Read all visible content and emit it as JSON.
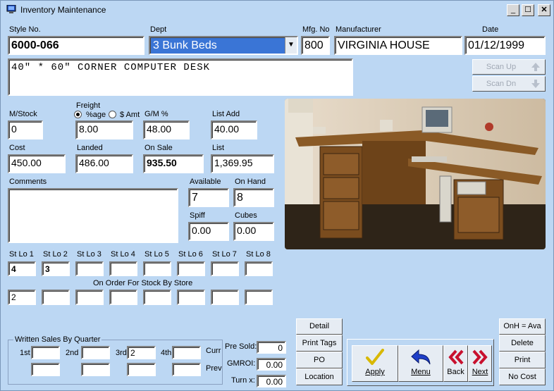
{
  "window": {
    "title": "Inventory Maintenance",
    "min": "_",
    "max": "☐",
    "close": "✕"
  },
  "labels": {
    "style_no": "Style No.",
    "dept": "Dept",
    "mfg_no": "Mfg. No",
    "manufacturer": "Manufacturer",
    "date": "Date",
    "mstock": "M/Stock",
    "freight": "Freight",
    "pct_age": "%age",
    "dollar_amt": "$ Amt",
    "gm_pct": "G/M %",
    "list_add": "List  Add",
    "cost": "Cost",
    "landed": "Landed",
    "on_sale": "On Sale",
    "list": "List",
    "comments": "Comments",
    "available": "Available",
    "on_hand": "On Hand",
    "spiff": "Spiff",
    "cubes": "Cubes",
    "on_order": "On Order For Stock By Store",
    "written_sales": "Written Sales By Quarter",
    "q1": "1st",
    "q2": "2nd",
    "q3": "3rd",
    "q4": "4th",
    "curr": "Curr",
    "prev": "Prev",
    "pre_sold": "Pre Sold:",
    "gmroi": "GMROI:",
    "turn": "Turn x:"
  },
  "fields": {
    "style_no": "6000-066",
    "dept": "3  Bunk Beds",
    "mfg_no": "800",
    "manufacturer": "VIRGINIA HOUSE",
    "date": "01/12/1999",
    "description": "40\" * 60\" CORNER COMPUTER DESK",
    "mstock": "0",
    "freight": "8.00",
    "gm_pct": "48.00",
    "list_add": "40.00",
    "cost": "450.00",
    "landed": "486.00",
    "on_sale": "935.50",
    "list": "1,369.95",
    "comments": "",
    "available": "7",
    "on_hand": "8",
    "spiff": "0.00",
    "cubes": "0.00",
    "pre_sold": "0",
    "gmroi": "0.00",
    "turn": "0.00",
    "q3_curr": "2"
  },
  "stores": {
    "labels": [
      "St Lo 1",
      "St Lo 2",
      "St Lo 3",
      "St Lo 4",
      "St Lo 5",
      "St Lo 6",
      "St Lo 7",
      "St Lo 8"
    ],
    "stock": [
      "4",
      "3",
      "",
      "",
      "",
      "",
      "",
      ""
    ],
    "on_order": [
      "2",
      "",
      "",
      "",
      "",
      "",
      "",
      ""
    ]
  },
  "buttons": {
    "scan_up": "Scan Up",
    "scan_dn": "Scan Dn",
    "detail": "Detail",
    "print_tags": "Print Tags",
    "po": "PO",
    "location": "Location",
    "apply": "Apply",
    "menu": "Menu",
    "back": "Back",
    "next": "Next",
    "onh_ava": "OnH = Ava",
    "delete": "Delete",
    "print": "Print",
    "no_cost": "No Cost"
  },
  "colors": {
    "background": "#bcd7f3",
    "dept_highlight": "#3a75d6",
    "back_next_red": "#c8102e",
    "menu_blue": "#1f3fc8",
    "apply_yellow": "#d8b800"
  }
}
